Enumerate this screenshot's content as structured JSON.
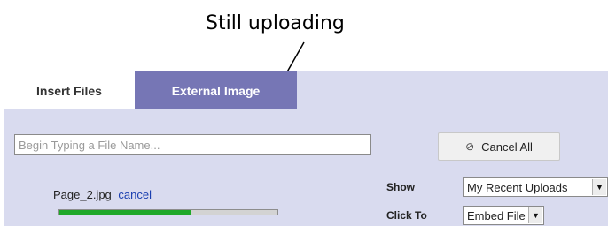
{
  "annotation": {
    "text": "Still uploading"
  },
  "tabs": [
    {
      "label": "Insert Files",
      "active": true
    },
    {
      "label": "External Image",
      "active": false
    }
  ],
  "search": {
    "placeholder": "Begin Typing a File Name..."
  },
  "cancel_all": {
    "label": "Cancel All",
    "icon": "cancel-circle-icon"
  },
  "upload": {
    "filename": "Page_2.jpg",
    "cancel_label": "cancel",
    "progress": 0.6
  },
  "options": {
    "show_label": "Show",
    "show_value": "My Recent Uploads",
    "click_label": "Click To",
    "click_value": "Embed File"
  },
  "colors": {
    "panel_bg": "#d9dbef",
    "tab_active_bg": "#ffffff",
    "tab_inactive_bg": "#7676b5",
    "progress_fill": "#1fa82a",
    "link": "#1a3fb0"
  }
}
